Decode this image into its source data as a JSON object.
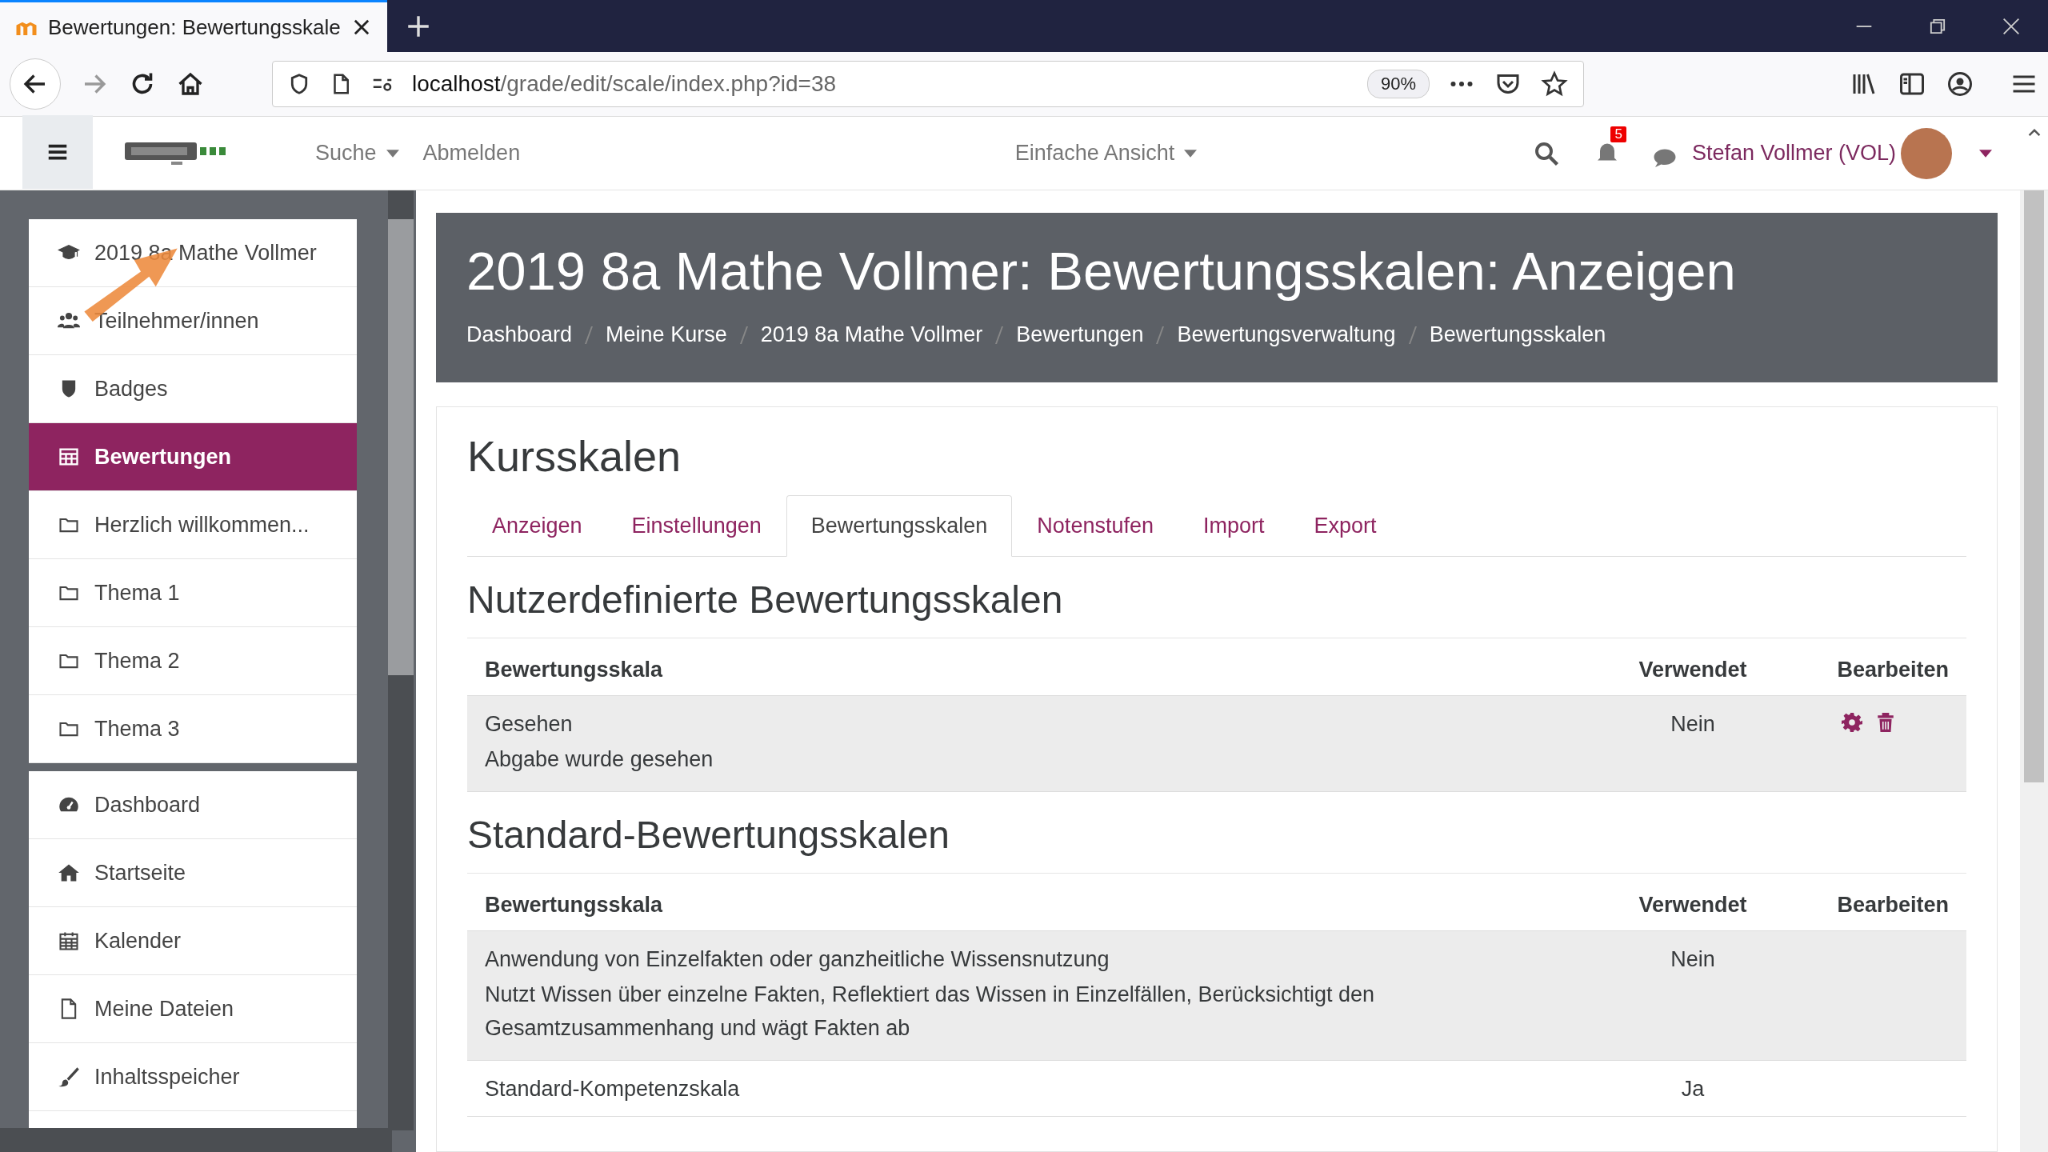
{
  "browser": {
    "tab_title": "Bewertungen: Bewertungsskale",
    "url_host": "localhost",
    "url_path": "/grade/edit/scale/index.php?id=38",
    "zoom": "90%"
  },
  "header": {
    "nav": [
      {
        "label": "Suche",
        "dropdown": true
      },
      {
        "label": "Abmelden",
        "dropdown": false
      }
    ],
    "view_mode": "Einfache Ansicht",
    "notification_count": "5",
    "user_name": "Stefan Vollmer (VOL)"
  },
  "sidebar": {
    "course_items": [
      {
        "label": "2019 8a Mathe Vollmer",
        "selected": false
      },
      {
        "label": "Teilnehmer/innen",
        "selected": false
      },
      {
        "label": "Badges",
        "selected": false
      },
      {
        "label": "Bewertungen",
        "selected": true
      },
      {
        "label": "Herzlich willkommen...",
        "selected": false
      },
      {
        "label": "Thema 1",
        "selected": false
      },
      {
        "label": "Thema 2",
        "selected": false
      },
      {
        "label": "Thema 3",
        "selected": false
      }
    ],
    "site_items": [
      {
        "label": "Dashboard",
        "selected": false
      },
      {
        "label": "Startseite",
        "selected": false
      },
      {
        "label": "Kalender",
        "selected": false
      },
      {
        "label": "Meine Dateien",
        "selected": false
      },
      {
        "label": "Inhaltsspeicher",
        "selected": false
      }
    ]
  },
  "page": {
    "title": "2019 8a Mathe Vollmer: Bewertungsskalen: Anzeigen",
    "breadcrumb": [
      "Dashboard",
      "Meine Kurse",
      "2019 8a Mathe Vollmer",
      "Bewertungen",
      "Bewertungsverwaltung",
      "Bewertungsskalen"
    ]
  },
  "card": {
    "heading": "Kursskalen",
    "tabs": [
      {
        "label": "Anzeigen",
        "selected": false
      },
      {
        "label": "Einstellungen",
        "selected": false
      },
      {
        "label": "Bewertungsskalen",
        "selected": true
      },
      {
        "label": "Notenstufen",
        "selected": false
      },
      {
        "label": "Import",
        "selected": false
      },
      {
        "label": "Export",
        "selected": false
      }
    ],
    "sections": [
      {
        "heading": "Nutzerdefinierte Bewertungsskalen",
        "columns": [
          "Bewertungsskala",
          "Verwendet",
          "Bearbeiten"
        ],
        "rows": [
          {
            "name": "Gesehen",
            "description": "Abgabe wurde gesehen",
            "used": "Nein",
            "editable": true
          }
        ]
      },
      {
        "heading": "Standard-Bewertungsskalen",
        "columns": [
          "Bewertungsskala",
          "Verwendet",
          "Bearbeiten"
        ],
        "rows": [
          {
            "name": "Anwendung von Einzelfakten oder ganzheitliche Wissensnutzung",
            "description": "Nutzt Wissen über einzelne Fakten, Reflektiert das Wissen in Einzelfällen, Berücksichtigt den Gesamtzusammenhang und wägt Fakten ab",
            "used": "Nein",
            "editable": false
          },
          {
            "name": "Standard-Kompetenzskala",
            "used": "Ja",
            "editable": false
          }
        ]
      }
    ]
  }
}
